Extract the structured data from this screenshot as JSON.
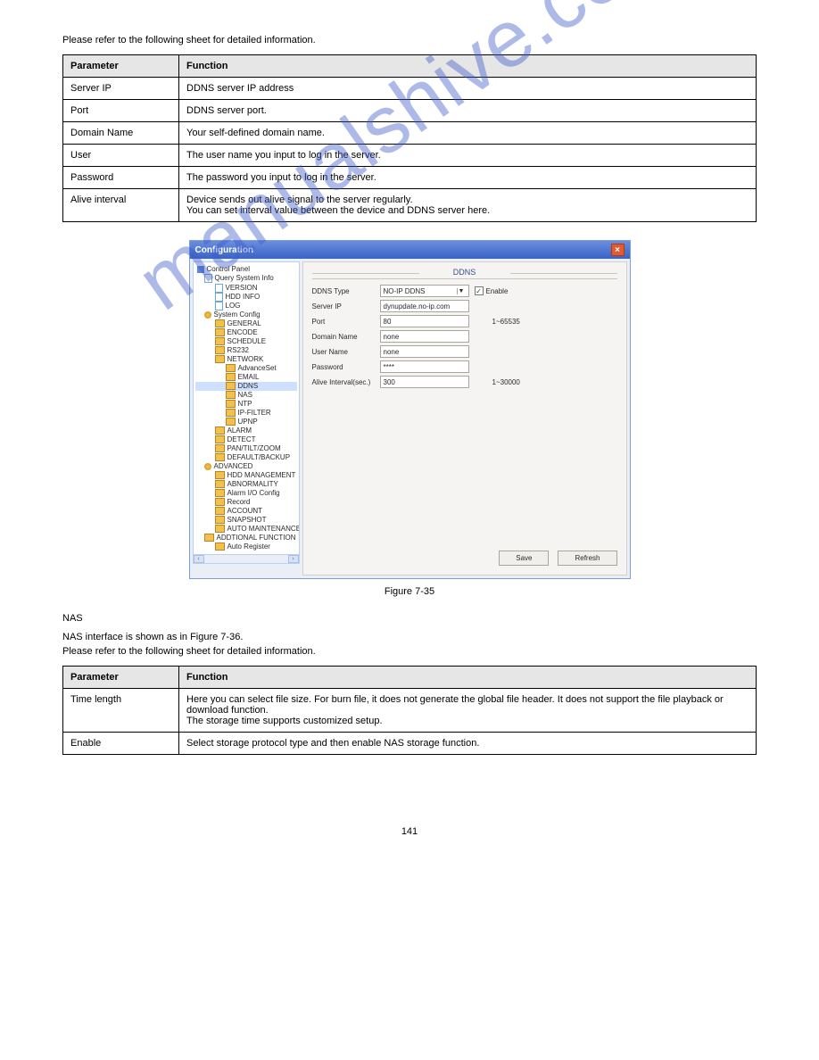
{
  "watermark": "manualshive.com",
  "intro1": "Please refer to the following sheet for detailed information.",
  "table1": {
    "head_param": "Parameter",
    "head_func": "Function",
    "rows": [
      {
        "param": "Server IP",
        "func": "DDNS server IP address"
      },
      {
        "param": "Port",
        "func": "DDNS server port."
      },
      {
        "param": "Domain Name",
        "func": "Your self-defined domain name."
      },
      {
        "param": "User",
        "func": "The user name you input to log in the server."
      },
      {
        "param": "Password",
        "func": "The password you input to log in the server."
      },
      {
        "param": "Alive interval",
        "func": "Device sends out alive signal to the server regularly.\nYou can set interval value between the device and DDNS server here."
      }
    ]
  },
  "config": {
    "title": "Configuration",
    "panel_title": "DDNS",
    "tree": {
      "control_panel": "Control Panel",
      "qsi": "Query System Info",
      "version": "VERSION",
      "hdd_info": "HDD INFO",
      "log": "LOG",
      "sys_config": "System Config",
      "general": "GENERAL",
      "encode": "ENCODE",
      "schedule": "SCHEDULE",
      "rs232": "RS232",
      "network": "NETWORK",
      "advanceset": "AdvanceSet",
      "email": "EMAIL",
      "ddns": "DDNS",
      "nas": "NAS",
      "ntp": "NTP",
      "ipfilter": "IP-FILTER",
      "upnp": "UPNP",
      "alarm": "ALARM",
      "detect": "DETECT",
      "ptz": "PAN/TILT/ZOOM",
      "default_backup": "DEFAULT/BACKUP",
      "advanced": "ADVANCED",
      "hdd_mgmt": "HDD MANAGEMENT",
      "abnormality": "ABNORMALITY",
      "alarm_io": "Alarm I/O Config",
      "record": "Record",
      "account": "ACCOUNT",
      "snapshot": "SNAPSHOT",
      "auto_maint": "AUTO MAINTENANCE",
      "add_func": "ADDTIONAL FUNCTION",
      "auto_reg": "Auto Register"
    },
    "labels": {
      "ddns_type": "DDNS Type",
      "server_ip": "Server IP",
      "port": "Port",
      "domain_name": "Domain Name",
      "user_name": "User Name",
      "password": "Password",
      "alive_interval": "Alive Interval(sec.)"
    },
    "values": {
      "ddns_type": "NO-IP DDNS",
      "enable": "Enable",
      "server_ip": "dynupdate.no-ip.com",
      "port": "80",
      "port_hint": "1~65535",
      "domain_name": "none",
      "user_name": "none",
      "password": "****",
      "alive_interval": "300",
      "alive_hint": "1~30000"
    },
    "buttons": {
      "save": "Save",
      "refresh": "Refresh"
    },
    "scroll_left": "‹",
    "scroll_right": "›"
  },
  "figcap1": "Figure 7-35",
  "heading_nas": "NAS",
  "nas_text": "NAS interface is shown as in Figure 7-36.\n Please refer to the following sheet for detailed information.",
  "table2": {
    "head_param": "Parameter",
    "head_func": "Function",
    "rows": [
      {
        "param": "Time length",
        "func": "Here you can select file size. For burn file, it does not generate the global file header. It does not support the file playback or download function.\nThe storage time supports customized setup."
      },
      {
        "param": "Enable",
        "func": "Select storage protocol type and then enable NAS storage function."
      }
    ]
  },
  "footer_pg": "141"
}
